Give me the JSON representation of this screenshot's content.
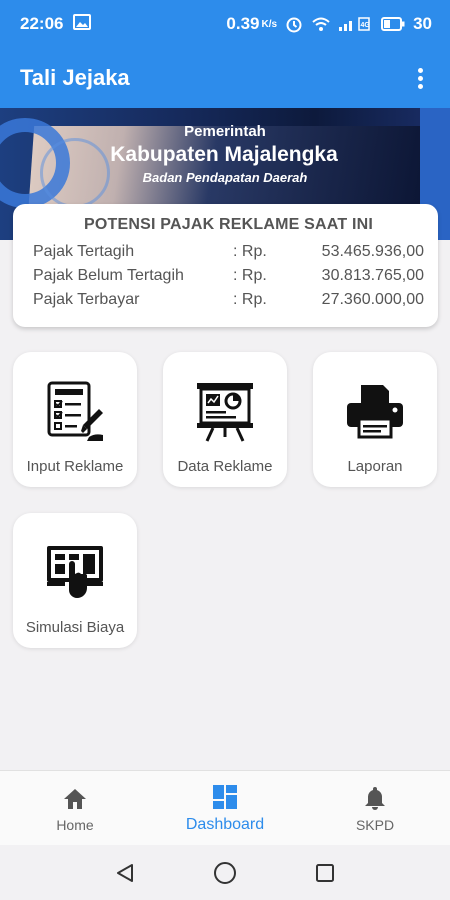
{
  "status_bar": {
    "time": "22:06",
    "speed": "0.39",
    "speed_unit": "K/s",
    "battery": "30"
  },
  "app_bar": {
    "title": "Tali Jejaka"
  },
  "banner": {
    "line1": "Pemerintah",
    "line2": "Kabupaten Majalengka",
    "line3": "Badan Pendapatan Daerah"
  },
  "summary": {
    "heading": "POTENSI PAJAK REKLAME SAAT INI",
    "rows": [
      {
        "label": "Pajak Tertagih",
        "currency": ": Rp.",
        "amount": "53.465.936,00"
      },
      {
        "label": "Pajak Belum Tertagih",
        "currency": ": Rp.",
        "amount": "30.813.765,00"
      },
      {
        "label": "Pajak Terbayar",
        "currency": ": Rp.",
        "amount": "27.360.000,00"
      }
    ]
  },
  "tiles": [
    {
      "label": "Input Reklame",
      "icon": "form-checklist-icon"
    },
    {
      "label": "Data Reklame",
      "icon": "presentation-board-icon"
    },
    {
      "label": "Laporan",
      "icon": "printer-icon"
    },
    {
      "label": "Simulasi Biaya",
      "icon": "touch-screen-icon"
    }
  ],
  "bottom_nav": {
    "items": [
      {
        "label": "Home",
        "icon": "home-icon"
      },
      {
        "label": "Dashboard",
        "icon": "dashboard-icon",
        "active": true
      },
      {
        "label": "SKPD",
        "icon": "bell-icon"
      }
    ]
  },
  "colors": {
    "primary": "#2d8ceb",
    "background": "#f2f1f3",
    "text": "#555555"
  }
}
